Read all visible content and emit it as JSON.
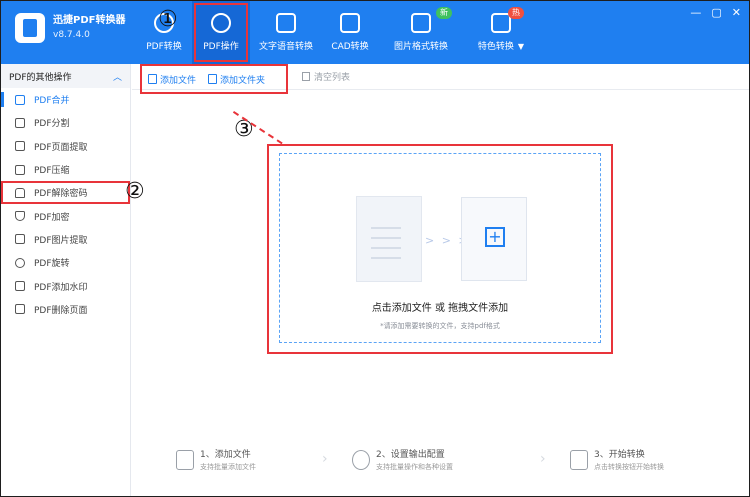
{
  "app": {
    "name": "迅捷PDF转换器",
    "version": "v8.7.4.0"
  },
  "nav": [
    {
      "label": "PDF转换",
      "icon": "pdf-convert-icon"
    },
    {
      "label": "PDF操作",
      "icon": "pdf-operate-icon",
      "active": true
    },
    {
      "label": "文字语音转换",
      "icon": "voice-icon"
    },
    {
      "label": "CAD转换",
      "icon": "cad-icon"
    },
    {
      "label": "图片格式转换",
      "icon": "image-icon",
      "badge": "新"
    },
    {
      "label": "特色转换",
      "icon": "special-icon",
      "badge": "热",
      "caret": "▼"
    }
  ],
  "window": {
    "minimize": "—",
    "restore": "▢",
    "close": "✕"
  },
  "sidebar": {
    "header": "PDF的其他操作",
    "collapse": "︿",
    "items": [
      {
        "label": "PDF合并",
        "active": true
      },
      {
        "label": "PDF分割"
      },
      {
        "label": "PDF页面提取"
      },
      {
        "label": "PDF压缩"
      },
      {
        "label": "PDF解除密码",
        "marked": true
      },
      {
        "label": "PDF加密"
      },
      {
        "label": "PDF图片提取"
      },
      {
        "label": "PDF旋转"
      },
      {
        "label": "PDF添加水印"
      },
      {
        "label": "PDF删除页面"
      }
    ]
  },
  "toolbar": {
    "add_file": "添加文件",
    "add_folder": "添加文件夹",
    "clear": "清空列表"
  },
  "dropzone": {
    "title": "点击添加文件 或 拖拽文件添加",
    "hint": "*请添加需要转换的文件，支持pdf格式",
    "arrows": "> > >",
    "plus": "+"
  },
  "annotations": {
    "one": "①",
    "two": "②",
    "three": "③"
  },
  "steps": [
    {
      "title": "1、添加文件",
      "sub": "支持批量添加文件"
    },
    {
      "title": "2、设置输出配置",
      "sub": "支持批量操作和各种设置"
    },
    {
      "title": "3、开始转换",
      "sub": "点击转换按钮开始转换"
    }
  ],
  "step_separator": "›",
  "colors": {
    "brand": "#1f7ff0",
    "highlight": "#e8343a"
  }
}
